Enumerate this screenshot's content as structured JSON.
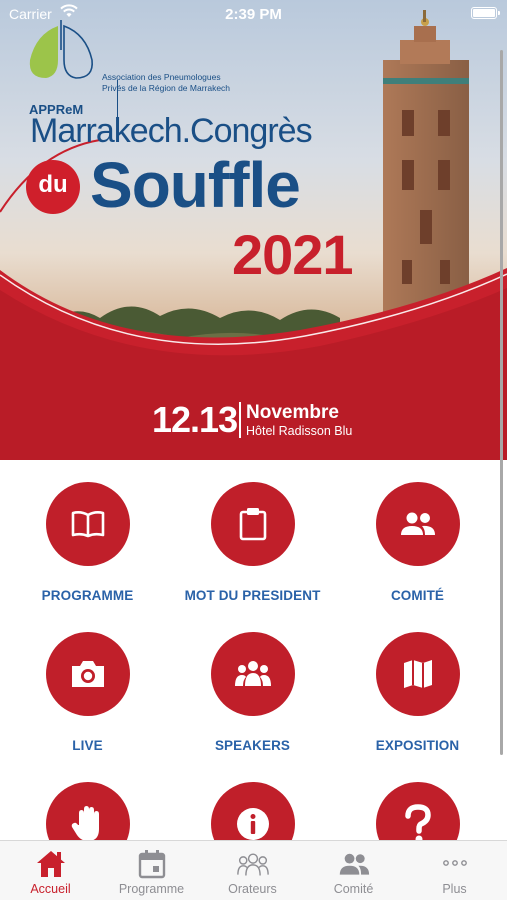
{
  "status_bar": {
    "carrier": "Carrier",
    "time": "2:39 PM"
  },
  "banner": {
    "logo_abbr": "APPReM",
    "association_line1": "Association des Pneumologues",
    "association_line2": "Privés de la Région de Marrakech",
    "title_city": "Marrakech.Congrès",
    "title_du": "du",
    "title_word": "Souffle",
    "title_year": "2021",
    "days": "12.13",
    "month": "Novembre",
    "venue": "Hôtel Radisson Blu"
  },
  "tiles": [
    {
      "label": "PROGRAMME",
      "icon": "book-open-icon"
    },
    {
      "label": "MOT DU PRESIDENT",
      "icon": "clipboard-icon"
    },
    {
      "label": "COMITÉ",
      "icon": "group-icon"
    },
    {
      "label": "LIVE",
      "icon": "camera-icon"
    },
    {
      "label": "SPEAKERS",
      "icon": "speakers-icon"
    },
    {
      "label": "EXPOSITION",
      "icon": "map-icon"
    },
    {
      "label": "",
      "icon": "hand-icon"
    },
    {
      "label": "",
      "icon": "info-icon"
    },
    {
      "label": "",
      "icon": "question-icon"
    }
  ],
  "tabs": [
    {
      "label": "Accueil",
      "icon": "home-icon",
      "active": true
    },
    {
      "label": "Programme",
      "icon": "calendar-icon",
      "active": false
    },
    {
      "label": "Orateurs",
      "icon": "people-outline-icon",
      "active": false
    },
    {
      "label": "Comité",
      "icon": "group-icon",
      "active": false
    },
    {
      "label": "Plus",
      "icon": "more-icon",
      "active": false
    }
  ],
  "colors": {
    "brand_red": "#c01f2a",
    "brand_blue": "#1a4f86",
    "label_blue": "#2a62a8",
    "tab_inactive": "#8e8e93"
  }
}
